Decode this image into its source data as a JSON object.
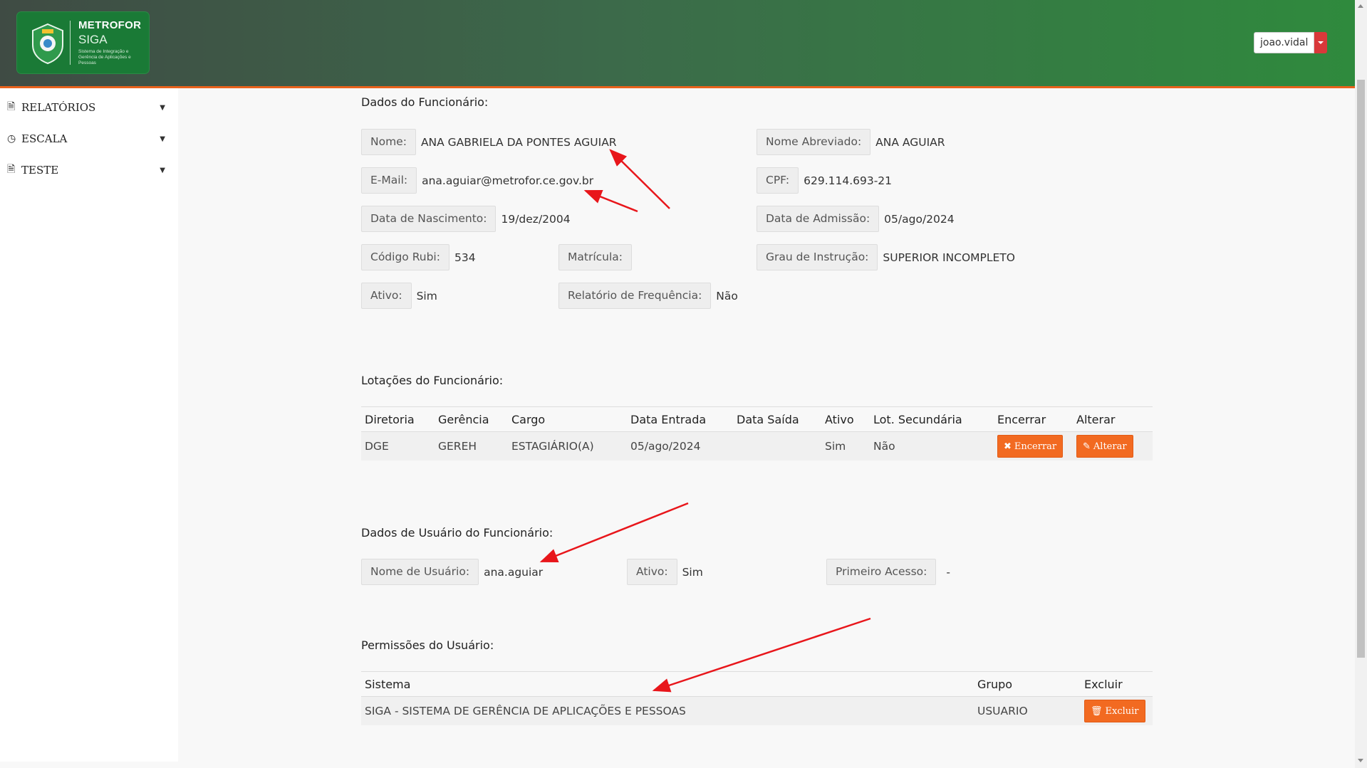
{
  "header": {
    "brand": "METROFOR",
    "system": "SIGA",
    "tagline": "Sistema de Integração e Gerência de Aplicações e Pessoas",
    "user": "joao.vidal"
  },
  "sidebar": {
    "items": [
      {
        "label": "RELATÓRIOS",
        "icon": "document-icon"
      },
      {
        "label": "ESCALA",
        "icon": "clock-icon"
      },
      {
        "label": "TESTE",
        "icon": "document-icon"
      }
    ]
  },
  "dados": {
    "title": "Dados do Funcionário:",
    "nome_label": "Nome:",
    "nome": "ANA GABRIELA DA PONTES AGUIAR",
    "nome_abrev_label": "Nome Abreviado:",
    "nome_abrev": "ANA AGUIAR",
    "email_label": "E-Mail:",
    "email": "ana.aguiar@metrofor.ce.gov.br",
    "cpf_label": "CPF:",
    "cpf": "629.114.693-21",
    "nasc_label": "Data de Nascimento:",
    "nasc": "19/dez/2004",
    "admissao_label": "Data de Admissão:",
    "admissao": "05/ago/2024",
    "rubi_label": "Código Rubi:",
    "rubi": "534",
    "matricula_label": "Matrícula:",
    "matricula": "",
    "instrucao_label": "Grau de Instrução:",
    "instrucao": "SUPERIOR INCOMPLETO",
    "ativo_label": "Ativo:",
    "ativo": "Sim",
    "freq_label": "Relatório de Frequência:",
    "freq": "Não"
  },
  "lotacoes": {
    "title": "Lotações do Funcionário:",
    "headers": [
      "Diretoria",
      "Gerência",
      "Cargo",
      "Data Entrada",
      "Data Saída",
      "Ativo",
      "Lot. Secundária",
      "Encerrar",
      "Alterar"
    ],
    "row": [
      "DGE",
      "GEREH",
      "ESTAGIÁRIO(A)",
      "05/ago/2024",
      "",
      "Sim",
      "Não"
    ],
    "encerrar_label": "Encerrar",
    "alterar_label": "Alterar"
  },
  "usuario": {
    "title": "Dados de Usuário do Funcionário:",
    "nome_label": "Nome de Usuário:",
    "nome": "ana.aguiar",
    "ativo_label": "Ativo:",
    "ativo": "Sim",
    "primeiro_label": "Primeiro Acesso:",
    "primeiro": "-"
  },
  "permissoes": {
    "title": "Permissões do Usuário:",
    "headers": [
      "Sistema",
      "Grupo",
      "Excluir"
    ],
    "row": [
      "SIGA - SISTEMA DE GERÊNCIA DE APLICAÇÕES E PESSOAS",
      "USUARIO"
    ],
    "excluir_label": "Excluir"
  },
  "colors": {
    "accent": "#f26a21",
    "header_green": "#2f8a3d",
    "arrow": "#e8161b"
  }
}
